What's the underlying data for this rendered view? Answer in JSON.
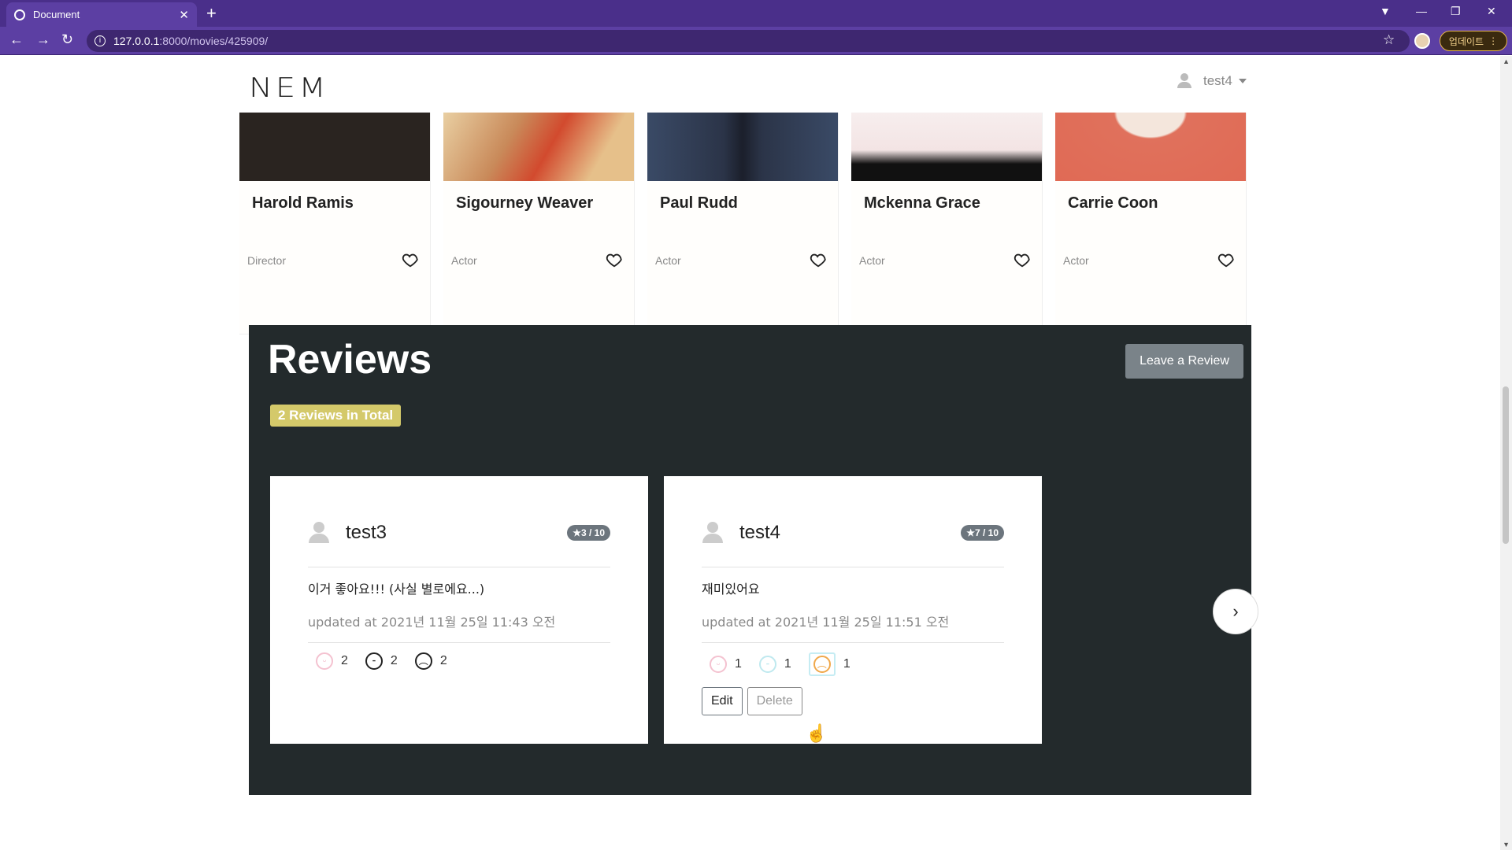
{
  "browser": {
    "tab_title": "Document",
    "url_host": "127.0.0.1",
    "url_rest": ":8000/movies/425909/",
    "update_label": "업데이트"
  },
  "navbar": {
    "logo": "NEM",
    "username": "test4"
  },
  "cast": [
    {
      "name": "Harold Ramis",
      "role": "Director",
      "image_color": "#2a2420"
    },
    {
      "name": "Sigourney Weaver",
      "role": "Actor",
      "image_color": "#c98a5a"
    },
    {
      "name": "Paul Rudd",
      "role": "Actor",
      "image_color": "#2f3b52"
    },
    {
      "name": "Mckenna Grace",
      "role": "Actor",
      "image_color": "#1a1414"
    },
    {
      "name": "Carrie Coon",
      "role": "Actor",
      "image_color": "#e0715c"
    }
  ],
  "reviews": {
    "title": "Reviews",
    "total_label": "2 Reviews in Total",
    "leave_label": "Leave a Review",
    "items": [
      {
        "user": "test3",
        "rating": "3 / 10",
        "content": "이거 좋아요!!! (사실 별로에요...)",
        "updated": "updated at 2021년 11월 25일 11:43 오전",
        "reactions": [
          "2",
          "2",
          "2"
        ]
      },
      {
        "user": "test4",
        "rating": "7 / 10",
        "content": "재미있어요",
        "updated": "updated at 2021년 11월 25일 11:51 오전",
        "reactions": [
          "1",
          "1",
          "1"
        ],
        "edit_label": "Edit",
        "delete_label": "Delete"
      }
    ]
  },
  "colors": {
    "brand": "#5c3fa3",
    "reviews_bg": "#232a2c",
    "badge": "#d4c96a"
  }
}
